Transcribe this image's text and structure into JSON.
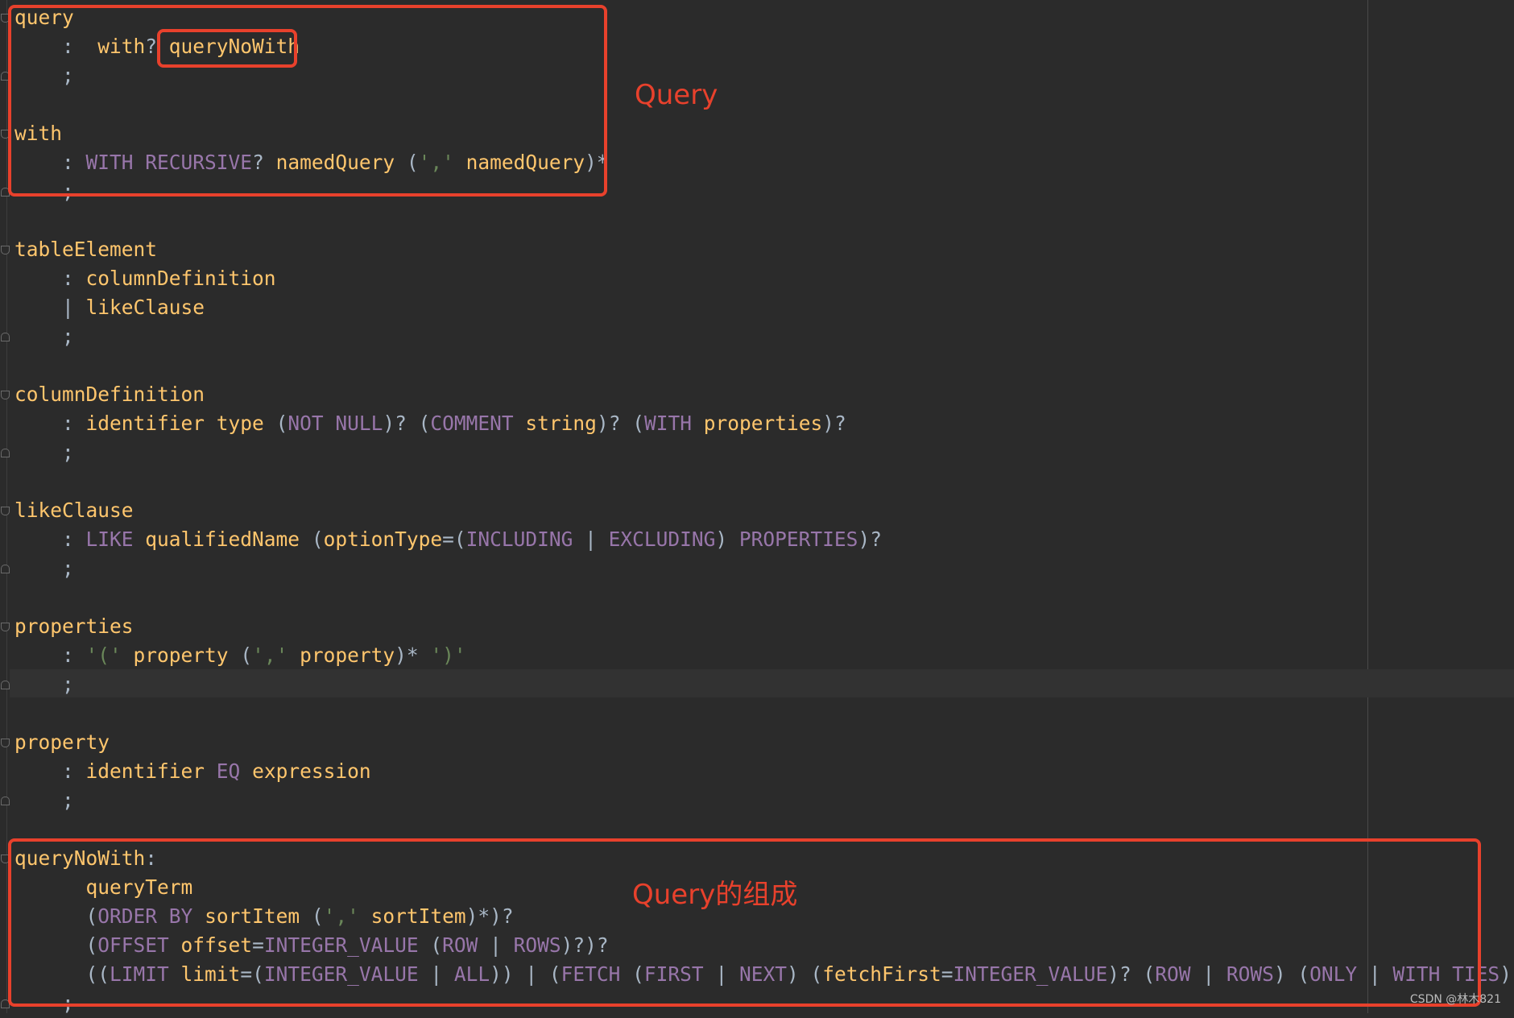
{
  "editor": {
    "lines": [
      [
        {
          "t": "query",
          "c": "r"
        }
      ],
      [
        {
          "t": "    :  ",
          "c": "o"
        },
        {
          "t": "with",
          "c": "r"
        },
        {
          "t": "? ",
          "c": "o"
        },
        {
          "t": "queryNoWith",
          "c": "r"
        }
      ],
      [
        {
          "t": "    ;",
          "c": "o"
        }
      ],
      [],
      [
        {
          "t": "with",
          "c": "r"
        }
      ],
      [
        {
          "t": "    : ",
          "c": "o"
        },
        {
          "t": "WITH",
          "c": "k"
        },
        {
          "t": " ",
          "c": "o"
        },
        {
          "t": "RECURSIVE",
          "c": "k"
        },
        {
          "t": "? ",
          "c": "o"
        },
        {
          "t": "namedQuery",
          "c": "r"
        },
        {
          "t": " (",
          "c": "o"
        },
        {
          "t": "','",
          "c": "s"
        },
        {
          "t": " ",
          "c": "o"
        },
        {
          "t": "namedQuery",
          "c": "r"
        },
        {
          "t": ")*",
          "c": "o"
        }
      ],
      [
        {
          "t": "    ;",
          "c": "o"
        }
      ],
      [],
      [
        {
          "t": "tableElement",
          "c": "r"
        }
      ],
      [
        {
          "t": "    : ",
          "c": "o"
        },
        {
          "t": "columnDefinition",
          "c": "r"
        }
      ],
      [
        {
          "t": "    | ",
          "c": "o"
        },
        {
          "t": "likeClause",
          "c": "r"
        }
      ],
      [
        {
          "t": "    ;",
          "c": "o"
        }
      ],
      [],
      [
        {
          "t": "columnDefinition",
          "c": "r"
        }
      ],
      [
        {
          "t": "    : ",
          "c": "o"
        },
        {
          "t": "identifier",
          "c": "r"
        },
        {
          "t": " ",
          "c": "o"
        },
        {
          "t": "type",
          "c": "r"
        },
        {
          "t": " (",
          "c": "o"
        },
        {
          "t": "NOT",
          "c": "k"
        },
        {
          "t": " ",
          "c": "o"
        },
        {
          "t": "NULL",
          "c": "k"
        },
        {
          "t": ")? (",
          "c": "o"
        },
        {
          "t": "COMMENT",
          "c": "k"
        },
        {
          "t": " ",
          "c": "o"
        },
        {
          "t": "string",
          "c": "r"
        },
        {
          "t": ")? (",
          "c": "o"
        },
        {
          "t": "WITH",
          "c": "k"
        },
        {
          "t": " ",
          "c": "o"
        },
        {
          "t": "properties",
          "c": "r"
        },
        {
          "t": ")?",
          "c": "o"
        }
      ],
      [
        {
          "t": "    ;",
          "c": "o"
        }
      ],
      [],
      [
        {
          "t": "likeClause",
          "c": "r"
        }
      ],
      [
        {
          "t": "    : ",
          "c": "o"
        },
        {
          "t": "LIKE",
          "c": "k"
        },
        {
          "t": " ",
          "c": "o"
        },
        {
          "t": "qualifiedName",
          "c": "r"
        },
        {
          "t": " (",
          "c": "o"
        },
        {
          "t": "optionType",
          "c": "r"
        },
        {
          "t": "=(",
          "c": "o"
        },
        {
          "t": "INCLUDING",
          "c": "k"
        },
        {
          "t": " | ",
          "c": "o"
        },
        {
          "t": "EXCLUDING",
          "c": "k"
        },
        {
          "t": ") ",
          "c": "o"
        },
        {
          "t": "PROPERTIES",
          "c": "k"
        },
        {
          "t": ")?",
          "c": "o"
        }
      ],
      [
        {
          "t": "    ;",
          "c": "o"
        }
      ],
      [],
      [
        {
          "t": "properties",
          "c": "r"
        }
      ],
      [
        {
          "t": "    : ",
          "c": "o"
        },
        {
          "t": "'('",
          "c": "s"
        },
        {
          "t": " ",
          "c": "o"
        },
        {
          "t": "property",
          "c": "r"
        },
        {
          "t": " (",
          "c": "o"
        },
        {
          "t": "','",
          "c": "s"
        },
        {
          "t": " ",
          "c": "o"
        },
        {
          "t": "property",
          "c": "r"
        },
        {
          "t": ")* ",
          "c": "o"
        },
        {
          "t": "')'",
          "c": "s"
        }
      ],
      [
        {
          "t": "    ;",
          "c": "o"
        }
      ],
      [],
      [
        {
          "t": "property",
          "c": "r"
        }
      ],
      [
        {
          "t": "    : ",
          "c": "o"
        },
        {
          "t": "identifier",
          "c": "r"
        },
        {
          "t": " ",
          "c": "o"
        },
        {
          "t": "EQ",
          "c": "k"
        },
        {
          "t": " ",
          "c": "o"
        },
        {
          "t": "expression",
          "c": "r"
        }
      ],
      [
        {
          "t": "    ;",
          "c": "o"
        }
      ],
      [],
      [
        {
          "t": "queryNoWith",
          "c": "r"
        },
        {
          "t": ":",
          "c": "o"
        }
      ],
      [
        {
          "t": "      ",
          "c": "o"
        },
        {
          "t": "queryTerm",
          "c": "r"
        }
      ],
      [
        {
          "t": "      (",
          "c": "o"
        },
        {
          "t": "ORDER",
          "c": "k"
        },
        {
          "t": " ",
          "c": "o"
        },
        {
          "t": "BY",
          "c": "k"
        },
        {
          "t": " ",
          "c": "o"
        },
        {
          "t": "sortItem",
          "c": "r"
        },
        {
          "t": " (",
          "c": "o"
        },
        {
          "t": "','",
          "c": "s"
        },
        {
          "t": " ",
          "c": "o"
        },
        {
          "t": "sortItem",
          "c": "r"
        },
        {
          "t": ")*)?",
          "c": "o"
        }
      ],
      [
        {
          "t": "      (",
          "c": "o"
        },
        {
          "t": "OFFSET",
          "c": "k"
        },
        {
          "t": " ",
          "c": "o"
        },
        {
          "t": "offset",
          "c": "r"
        },
        {
          "t": "=",
          "c": "o"
        },
        {
          "t": "INTEGER_VALUE",
          "c": "k"
        },
        {
          "t": " (",
          "c": "o"
        },
        {
          "t": "ROW",
          "c": "k"
        },
        {
          "t": " | ",
          "c": "o"
        },
        {
          "t": "ROWS",
          "c": "k"
        },
        {
          "t": ")?)?",
          "c": "o"
        }
      ],
      [
        {
          "t": "      ((",
          "c": "o"
        },
        {
          "t": "LIMIT",
          "c": "k"
        },
        {
          "t": " ",
          "c": "o"
        },
        {
          "t": "limit",
          "c": "r"
        },
        {
          "t": "=(",
          "c": "o"
        },
        {
          "t": "INTEGER_VALUE",
          "c": "k"
        },
        {
          "t": " | ",
          "c": "o"
        },
        {
          "t": "ALL",
          "c": "k"
        },
        {
          "t": ")) | (",
          "c": "o"
        },
        {
          "t": "FETCH",
          "c": "k"
        },
        {
          "t": " (",
          "c": "o"
        },
        {
          "t": "FIRST",
          "c": "k"
        },
        {
          "t": " | ",
          "c": "o"
        },
        {
          "t": "NEXT",
          "c": "k"
        },
        {
          "t": ") (",
          "c": "o"
        },
        {
          "t": "fetchFirst",
          "c": "r"
        },
        {
          "t": "=",
          "c": "o"
        },
        {
          "t": "INTEGER_VALUE",
          "c": "k"
        },
        {
          "t": ")? (",
          "c": "o"
        },
        {
          "t": "ROW",
          "c": "k"
        },
        {
          "t": " | ",
          "c": "o"
        },
        {
          "t": "ROWS",
          "c": "k"
        },
        {
          "t": ") (",
          "c": "o"
        },
        {
          "t": "ONLY",
          "c": "k"
        },
        {
          "t": " | ",
          "c": "o"
        },
        {
          "t": "WITH",
          "c": "k"
        },
        {
          "t": " ",
          "c": "o"
        },
        {
          "t": "TIES",
          "c": "k"
        },
        {
          "t": ")))?",
          "c": "o"
        }
      ],
      [
        {
          "t": "    ;",
          "c": "o"
        }
      ]
    ]
  },
  "annotations": {
    "query_label": "Query",
    "composition_label": "Query的组成"
  },
  "watermark": "CSDN @林木821",
  "colors": {
    "background": "#2b2b2b",
    "rule": "#ffc66d",
    "token": "#9876aa",
    "string": "#6a8759",
    "punctuation": "#a9b7c6",
    "annotation": "#e8412c"
  }
}
